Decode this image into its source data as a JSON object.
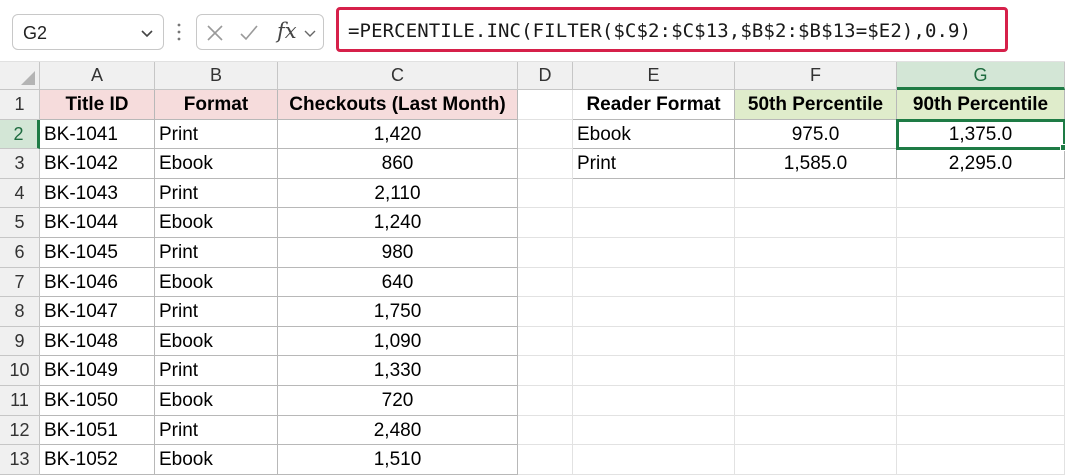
{
  "formula_bar": {
    "name_box": "G2",
    "fx_label": "fx",
    "formula": "=PERCENTILE.INC(FILTER($C$2:$C$13,$B$2:$B$13=$E2),0.9)"
  },
  "colors": {
    "formula_highlight": "#d6204a",
    "selection_green": "#1e7b45",
    "header_pink": "#f6dcdc",
    "header_green": "#dfeccb"
  },
  "columns": [
    "A",
    "B",
    "C",
    "D",
    "E",
    "F",
    "G"
  ],
  "rows": [
    "1",
    "2",
    "3",
    "4",
    "5",
    "6",
    "7",
    "8",
    "9",
    "10",
    "11",
    "12",
    "13"
  ],
  "main_table": {
    "headers": [
      "Title ID",
      "Format",
      "Checkouts (Last Month)"
    ],
    "rows": [
      [
        "BK-1041",
        "Print",
        "1,420"
      ],
      [
        "BK-1042",
        "Ebook",
        "860"
      ],
      [
        "BK-1043",
        "Print",
        "2,110"
      ],
      [
        "BK-1044",
        "Ebook",
        "1,240"
      ],
      [
        "BK-1045",
        "Print",
        "980"
      ],
      [
        "BK-1046",
        "Ebook",
        "640"
      ],
      [
        "BK-1047",
        "Print",
        "1,750"
      ],
      [
        "BK-1048",
        "Ebook",
        "1,090"
      ],
      [
        "BK-1049",
        "Print",
        "1,330"
      ],
      [
        "BK-1050",
        "Ebook",
        "720"
      ],
      [
        "BK-1051",
        "Print",
        "2,480"
      ],
      [
        "BK-1052",
        "Ebook",
        "1,510"
      ]
    ]
  },
  "summary_table": {
    "headers": [
      "Reader Format",
      "50th Percentile",
      "90th Percentile"
    ],
    "rows": [
      [
        "Ebook",
        "975.0",
        "1,375.0"
      ],
      [
        "Print",
        "1,585.0",
        "2,295.0"
      ]
    ]
  },
  "selection": {
    "cell": "G2",
    "column": "G",
    "row": "2"
  }
}
